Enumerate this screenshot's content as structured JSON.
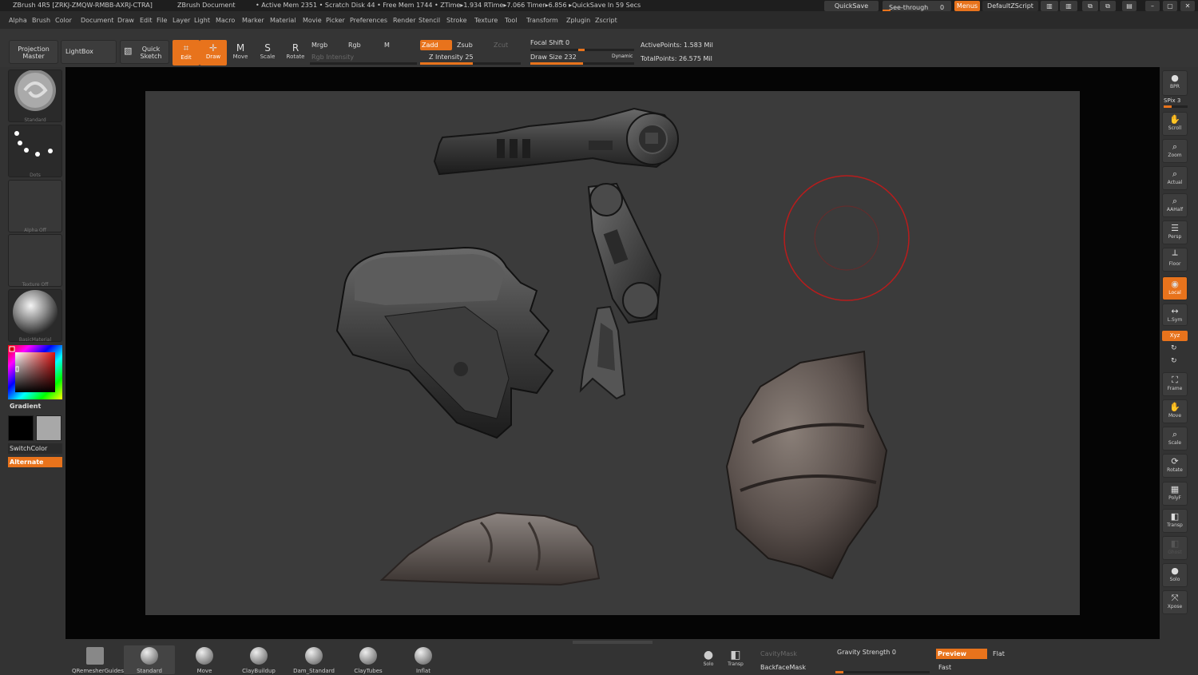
{
  "titlebar": {
    "app": "ZBrush 4R5 [ZRKJ-ZMQW-RMBB-AXRJ-CTRA]",
    "doc": "ZBrush Document",
    "stats": "• Active Mem 2351 • Scratch Disk 44 • Free Mem 1744 • ZTime▸1.934 RTime▸7.066 Timer▸6.856 ▸QuickSave In 59 Secs",
    "quicksave": "QuickSave",
    "seethrough": "See-through",
    "seethrough_value": "0",
    "menus": "Menus",
    "script": "DefaultZScript"
  },
  "menus": [
    "Alpha",
    "Brush",
    "Color",
    "Document",
    "Draw",
    "Edit",
    "File",
    "Layer",
    "Light",
    "Macro",
    "Marker",
    "Material",
    "Movie",
    "Picker",
    "Preferences",
    "Render",
    "Stencil",
    "Stroke",
    "Texture",
    "Tool",
    "Transform",
    "Zplugin",
    "Zscript"
  ],
  "shelf": {
    "projection_master": "Projection Master",
    "lightbox": "LightBox",
    "quick_sketch": "Quick Sketch",
    "edit": "Edit",
    "draw": "Draw",
    "move": "Move",
    "scale": "Scale",
    "rotate": "Rotate",
    "mrgb": "Mrgb",
    "rgb": "Rgb",
    "m": "M",
    "rgb_intensity": "Rgb Intensity",
    "zadd": "Zadd",
    "zsub": "Zsub",
    "zcut": "Zcut",
    "z_intensity": "Z Intensity 25",
    "focal_shift": "Focal Shift 0",
    "draw_size": "Draw Size 232",
    "dynamic": "Dynamic",
    "active_points": "ActivePoints: 1.583  Mil",
    "total_points": "TotalPoints: 26.575  Mil"
  },
  "left": {
    "brush_label": "Standard",
    "stroke_label": "Dots",
    "alpha_label": "Alpha  Off",
    "texture_label": "Texture  Off",
    "material_label": "BasicMaterial",
    "gradient": "Gradient",
    "switchcolor": "SwitchColor",
    "alternate": "Alternate"
  },
  "right": {
    "bpr": "BPR",
    "spix": "SPix 3",
    "buttons": [
      "Scroll",
      "Zoom",
      "Actual",
      "AAHalf",
      "Persp",
      "Floor",
      "Local",
      "L.Sym",
      "Frame",
      "Move",
      "Scale",
      "Rotate",
      "PolyF",
      "Transp",
      "Ghost",
      "Solo",
      "Xpose"
    ],
    "xyz": "Xyz"
  },
  "bottom": {
    "brushes": [
      "QRemesherGuides",
      "Standard",
      "Move",
      "ClayBuildup",
      "Dam_Standard",
      "ClayTubes",
      "Inflat"
    ],
    "solo": "Solo",
    "transp": "Transp",
    "cavitymask": "CavityMask",
    "backfacemask": "BackfaceMask",
    "gravity": "Gravity Strength 0",
    "preview": "Preview",
    "flat": "Flat",
    "fast": "Fast"
  },
  "colors": {
    "accent": "#e8731c",
    "brush_cursor": "#b81c1c"
  }
}
